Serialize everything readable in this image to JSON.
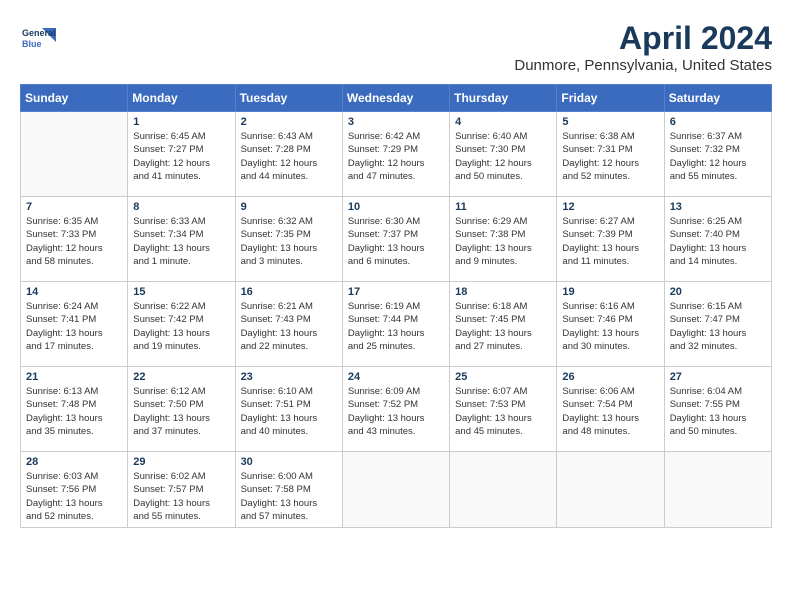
{
  "header": {
    "logo_line1": "General",
    "logo_line2": "Blue",
    "month": "April 2024",
    "location": "Dunmore, Pennsylvania, United States"
  },
  "columns": [
    "Sunday",
    "Monday",
    "Tuesday",
    "Wednesday",
    "Thursday",
    "Friday",
    "Saturday"
  ],
  "weeks": [
    [
      {
        "day": "",
        "info": ""
      },
      {
        "day": "1",
        "info": "Sunrise: 6:45 AM\nSunset: 7:27 PM\nDaylight: 12 hours\nand 41 minutes."
      },
      {
        "day": "2",
        "info": "Sunrise: 6:43 AM\nSunset: 7:28 PM\nDaylight: 12 hours\nand 44 minutes."
      },
      {
        "day": "3",
        "info": "Sunrise: 6:42 AM\nSunset: 7:29 PM\nDaylight: 12 hours\nand 47 minutes."
      },
      {
        "day": "4",
        "info": "Sunrise: 6:40 AM\nSunset: 7:30 PM\nDaylight: 12 hours\nand 50 minutes."
      },
      {
        "day": "5",
        "info": "Sunrise: 6:38 AM\nSunset: 7:31 PM\nDaylight: 12 hours\nand 52 minutes."
      },
      {
        "day": "6",
        "info": "Sunrise: 6:37 AM\nSunset: 7:32 PM\nDaylight: 12 hours\nand 55 minutes."
      }
    ],
    [
      {
        "day": "7",
        "info": "Sunrise: 6:35 AM\nSunset: 7:33 PM\nDaylight: 12 hours\nand 58 minutes."
      },
      {
        "day": "8",
        "info": "Sunrise: 6:33 AM\nSunset: 7:34 PM\nDaylight: 13 hours\nand 1 minute."
      },
      {
        "day": "9",
        "info": "Sunrise: 6:32 AM\nSunset: 7:35 PM\nDaylight: 13 hours\nand 3 minutes."
      },
      {
        "day": "10",
        "info": "Sunrise: 6:30 AM\nSunset: 7:37 PM\nDaylight: 13 hours\nand 6 minutes."
      },
      {
        "day": "11",
        "info": "Sunrise: 6:29 AM\nSunset: 7:38 PM\nDaylight: 13 hours\nand 9 minutes."
      },
      {
        "day": "12",
        "info": "Sunrise: 6:27 AM\nSunset: 7:39 PM\nDaylight: 13 hours\nand 11 minutes."
      },
      {
        "day": "13",
        "info": "Sunrise: 6:25 AM\nSunset: 7:40 PM\nDaylight: 13 hours\nand 14 minutes."
      }
    ],
    [
      {
        "day": "14",
        "info": "Sunrise: 6:24 AM\nSunset: 7:41 PM\nDaylight: 13 hours\nand 17 minutes."
      },
      {
        "day": "15",
        "info": "Sunrise: 6:22 AM\nSunset: 7:42 PM\nDaylight: 13 hours\nand 19 minutes."
      },
      {
        "day": "16",
        "info": "Sunrise: 6:21 AM\nSunset: 7:43 PM\nDaylight: 13 hours\nand 22 minutes."
      },
      {
        "day": "17",
        "info": "Sunrise: 6:19 AM\nSunset: 7:44 PM\nDaylight: 13 hours\nand 25 minutes."
      },
      {
        "day": "18",
        "info": "Sunrise: 6:18 AM\nSunset: 7:45 PM\nDaylight: 13 hours\nand 27 minutes."
      },
      {
        "day": "19",
        "info": "Sunrise: 6:16 AM\nSunset: 7:46 PM\nDaylight: 13 hours\nand 30 minutes."
      },
      {
        "day": "20",
        "info": "Sunrise: 6:15 AM\nSunset: 7:47 PM\nDaylight: 13 hours\nand 32 minutes."
      }
    ],
    [
      {
        "day": "21",
        "info": "Sunrise: 6:13 AM\nSunset: 7:48 PM\nDaylight: 13 hours\nand 35 minutes."
      },
      {
        "day": "22",
        "info": "Sunrise: 6:12 AM\nSunset: 7:50 PM\nDaylight: 13 hours\nand 37 minutes."
      },
      {
        "day": "23",
        "info": "Sunrise: 6:10 AM\nSunset: 7:51 PM\nDaylight: 13 hours\nand 40 minutes."
      },
      {
        "day": "24",
        "info": "Sunrise: 6:09 AM\nSunset: 7:52 PM\nDaylight: 13 hours\nand 43 minutes."
      },
      {
        "day": "25",
        "info": "Sunrise: 6:07 AM\nSunset: 7:53 PM\nDaylight: 13 hours\nand 45 minutes."
      },
      {
        "day": "26",
        "info": "Sunrise: 6:06 AM\nSunset: 7:54 PM\nDaylight: 13 hours\nand 48 minutes."
      },
      {
        "day": "27",
        "info": "Sunrise: 6:04 AM\nSunset: 7:55 PM\nDaylight: 13 hours\nand 50 minutes."
      }
    ],
    [
      {
        "day": "28",
        "info": "Sunrise: 6:03 AM\nSunset: 7:56 PM\nDaylight: 13 hours\nand 52 minutes."
      },
      {
        "day": "29",
        "info": "Sunrise: 6:02 AM\nSunset: 7:57 PM\nDaylight: 13 hours\nand 55 minutes."
      },
      {
        "day": "30",
        "info": "Sunrise: 6:00 AM\nSunset: 7:58 PM\nDaylight: 13 hours\nand 57 minutes."
      },
      {
        "day": "",
        "info": ""
      },
      {
        "day": "",
        "info": ""
      },
      {
        "day": "",
        "info": ""
      },
      {
        "day": "",
        "info": ""
      }
    ]
  ]
}
